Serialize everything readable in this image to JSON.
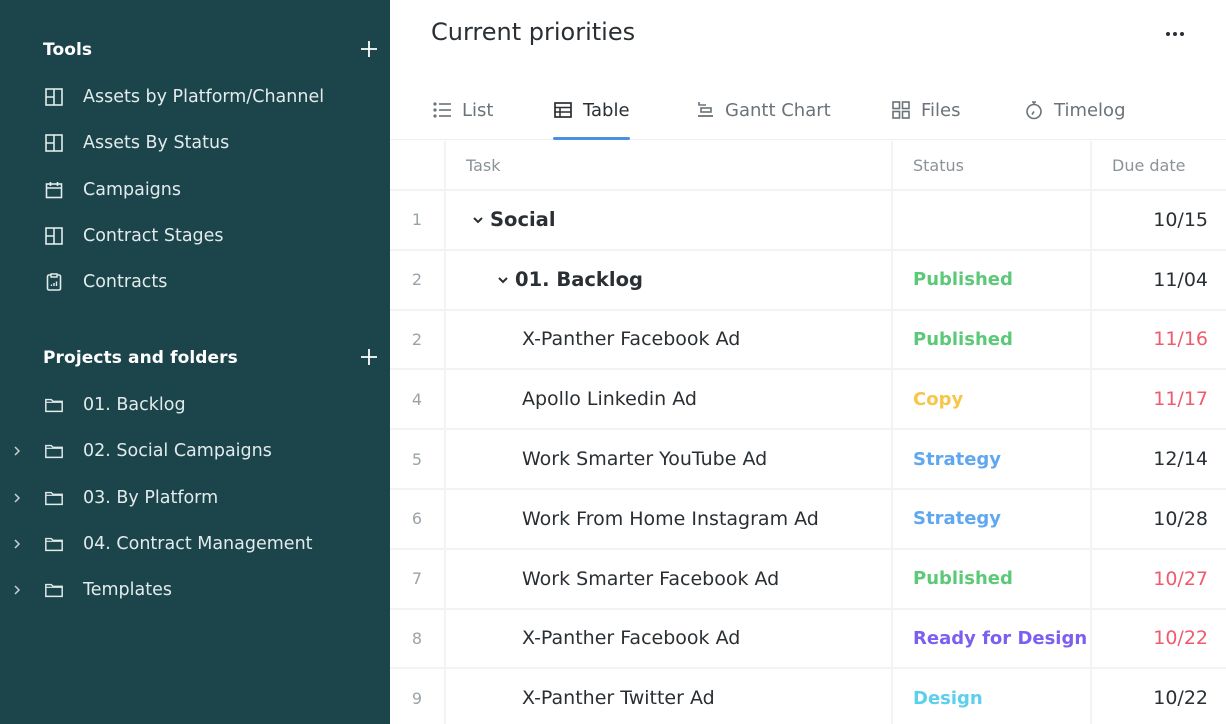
{
  "sidebar": {
    "tools_section": {
      "title": "Tools",
      "items": [
        {
          "label": "Assets by Platform/Channel",
          "icon": "board-icon"
        },
        {
          "label": "Assets By Status",
          "icon": "board-icon"
        },
        {
          "label": "Campaigns",
          "icon": "calendar-icon"
        },
        {
          "label": "Contract Stages",
          "icon": "board-icon"
        },
        {
          "label": "Contracts",
          "icon": "report-icon"
        }
      ]
    },
    "projects_section": {
      "title": "Projects and folders",
      "items": [
        {
          "label": "01. Backlog",
          "icon": "folder-icon",
          "expandable": false
        },
        {
          "label": "02. Social Campaigns",
          "icon": "folder-icon",
          "expandable": true
        },
        {
          "label": "03. By Platform",
          "icon": "folder-icon",
          "expandable": true
        },
        {
          "label": "04. Contract Management",
          "icon": "folder-icon",
          "expandable": true
        },
        {
          "label": "Templates",
          "icon": "folder-icon",
          "expandable": true
        }
      ]
    }
  },
  "main": {
    "title": "Current priorities",
    "more_icon": "more-horizontal-icon",
    "tabs": [
      {
        "label": "List",
        "icon": "list-icon",
        "active": false
      },
      {
        "label": "Table",
        "icon": "table-icon",
        "active": true
      },
      {
        "label": "Gantt Chart",
        "icon": "gantt-icon",
        "active": false
      },
      {
        "label": "Files",
        "icon": "files-grid-icon",
        "active": false
      },
      {
        "label": "Timelog",
        "icon": "stopwatch-icon",
        "active": false
      }
    ],
    "table": {
      "columns": [
        "Task",
        "Status",
        "Due date"
      ],
      "rows": [
        {
          "num": "1",
          "task": "Social",
          "level": 0,
          "collapsible": true,
          "status": "",
          "status_color": "",
          "due": "10/15",
          "overdue": false
        },
        {
          "num": "2",
          "task": "01. Backlog",
          "level": 1,
          "collapsible": true,
          "status": "Published",
          "status_color": "#5cc978",
          "due": "11/04",
          "overdue": false
        },
        {
          "num": "2",
          "task": "X-Panther Facebook Ad",
          "level": 2,
          "collapsible": false,
          "status": "Published",
          "status_color": "#5cc978",
          "due": "11/16",
          "overdue": true
        },
        {
          "num": "4",
          "task": "Apollo Linkedin Ad",
          "level": 2,
          "collapsible": false,
          "status": "Copy",
          "status_color": "#f7c548",
          "due": "11/17",
          "overdue": true
        },
        {
          "num": "5",
          "task": "Work Smarter YouTube Ad",
          "level": 2,
          "collapsible": false,
          "status": "Strategy",
          "status_color": "#5fa8f0",
          "due": "12/14",
          "overdue": false
        },
        {
          "num": "6",
          "task": "Work From Home Instagram Ad",
          "level": 2,
          "collapsible": false,
          "status": "Strategy",
          "status_color": "#5fa8f0",
          "due": "10/28",
          "overdue": false
        },
        {
          "num": "7",
          "task": "Work Smarter Facebook Ad",
          "level": 2,
          "collapsible": false,
          "status": "Published",
          "status_color": "#5cc978",
          "due": "10/27",
          "overdue": true
        },
        {
          "num": "8",
          "task": "X-Panther Facebook Ad",
          "level": 2,
          "collapsible": false,
          "status": "Ready for Design",
          "status_color": "#7b5ff0",
          "due": "10/22",
          "overdue": true
        },
        {
          "num": "9",
          "task": "X-Panther Twitter Ad",
          "level": 2,
          "collapsible": false,
          "status": "Design",
          "status_color": "#5bd0ec",
          "due": "10/22",
          "overdue": false
        }
      ]
    }
  },
  "colors": {
    "sidebar_bg": "#1c444b",
    "active_tab_underline": "#4a90e2",
    "overdue_date": "#ef5b6c"
  }
}
